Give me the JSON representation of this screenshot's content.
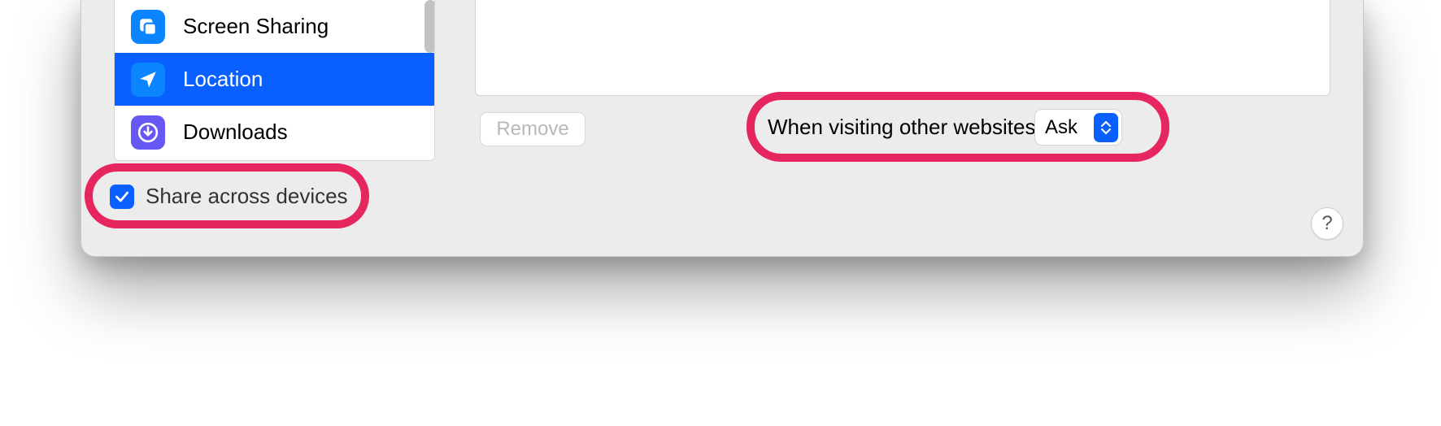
{
  "sidebar": {
    "items": [
      {
        "label": "Screen Sharing",
        "icon": "screen-sharing-icon",
        "iconColor": "blue",
        "selected": false
      },
      {
        "label": "Location",
        "icon": "location-icon",
        "iconColor": "blue",
        "selected": true
      },
      {
        "label": "Downloads",
        "icon": "downloads-icon",
        "iconColor": "purple",
        "selected": false
      }
    ]
  },
  "buttons": {
    "remove": "Remove"
  },
  "when_visiting": {
    "label": "When visiting other websites:",
    "selected": "Ask"
  },
  "share_across_devices": {
    "label": "Share across devices",
    "checked": true
  },
  "help_button": "?"
}
